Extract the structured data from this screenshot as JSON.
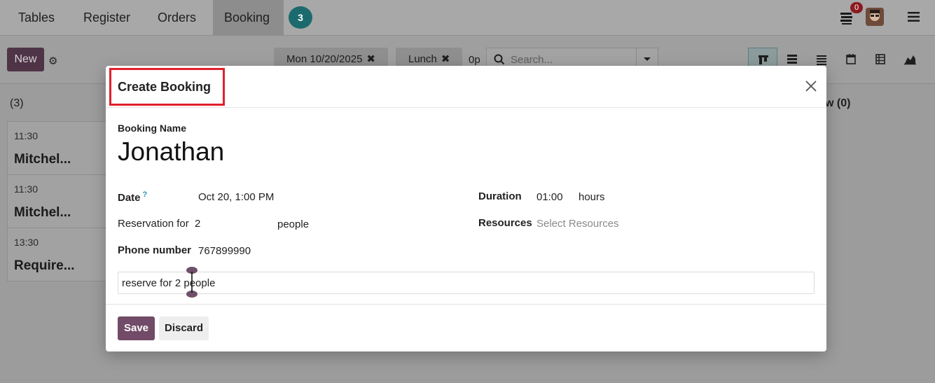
{
  "nav": {
    "items": [
      {
        "label": "Tables"
      },
      {
        "label": "Register"
      },
      {
        "label": "Orders"
      },
      {
        "label": "Booking"
      }
    ],
    "badge": "3",
    "notification_count": "0"
  },
  "controls": {
    "new_label": "New",
    "facets": [
      {
        "label": "Mon 10/20/2025"
      },
      {
        "label": "Lunch"
      }
    ],
    "facet_extra": "0p",
    "search_placeholder": "Search..."
  },
  "kanban": {
    "column1_header": "(3)",
    "column2_header": "w (0)",
    "cards": [
      {
        "time": "11:30",
        "name": "Mitchel..."
      },
      {
        "time": "11:30",
        "name": "Mitchel..."
      },
      {
        "time": "13:30",
        "name": "Require..."
      }
    ]
  },
  "dialog": {
    "title": "Create Booking",
    "booking_name_label": "Booking Name",
    "booking_name_value": "Jonathan",
    "date_label": "Date",
    "date_help": "?",
    "date_value": "Oct 20, 1:00 PM",
    "reservation_label": "Reservation for",
    "reservation_value": "2",
    "reservation_unit": "people",
    "phone_label": "Phone number",
    "phone_value": "767899990",
    "duration_label": "Duration",
    "duration_value": "01:00",
    "duration_unit": "hours",
    "resources_label": "Resources",
    "resources_placeholder": "Select Resources",
    "note_value": "reserve for 2 people",
    "save_label": "Save",
    "discard_label": "Discard"
  },
  "colors": {
    "primary": "#714b67",
    "highlight": "#e0202e",
    "badge": "#1b6a6e"
  }
}
